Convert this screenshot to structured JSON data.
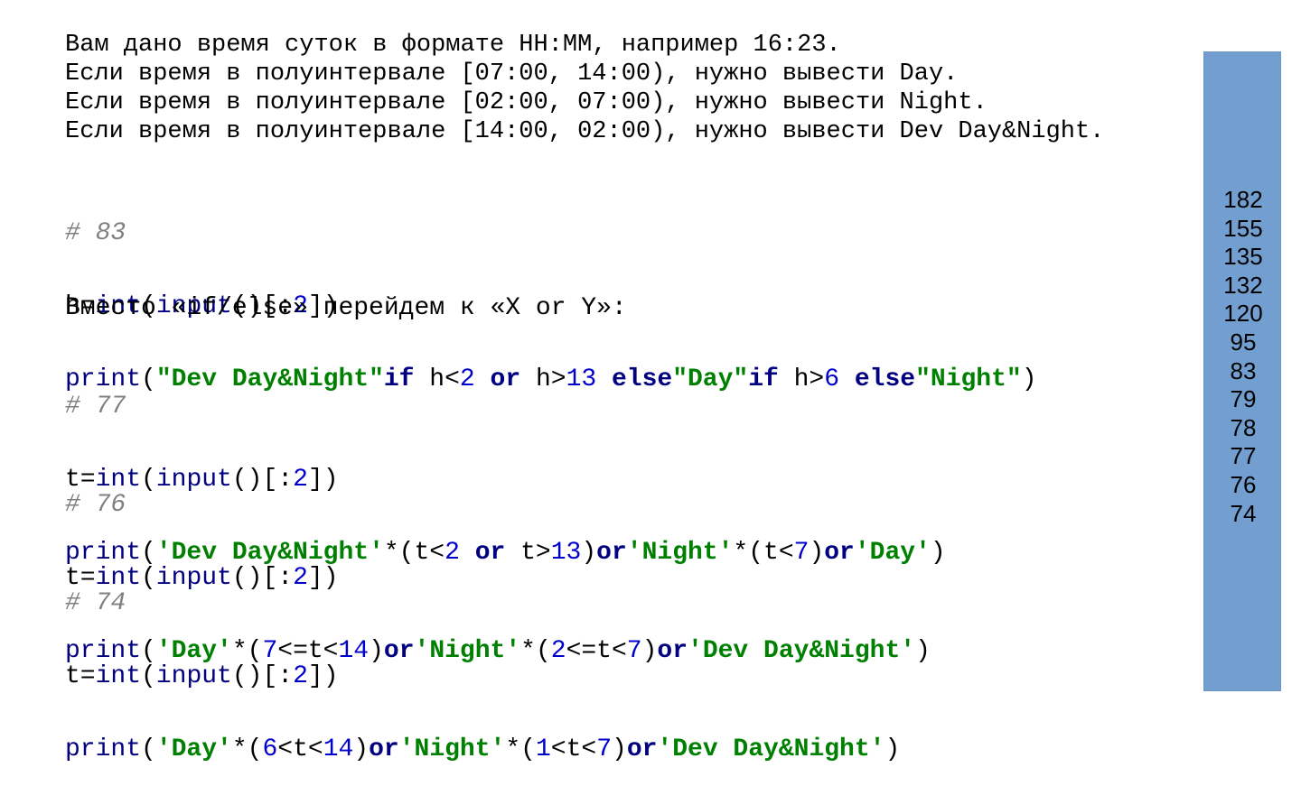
{
  "task_lines": [
    "Вам дано время суток в формате HH:MM, например 16:23.",
    "Если время в полуинтервале [07:00, 14:00), нужно вывести Day.",
    "Если время в полуинтервале [02:00, 07:00), нужно вывести Night.",
    "Если время в полуинтервале [14:00, 02:00), нужно вывести Dev Day&Night."
  ],
  "block1": {
    "comment": "# 83",
    "line1": [
      "h=",
      "int",
      "(",
      "input",
      "()[:",
      "2",
      "])"
    ],
    "line2": [
      "print",
      "(",
      "\"Dev Day&Night\"",
      "if",
      " h<",
      "2",
      " ",
      "or",
      " h>",
      "13",
      " ",
      "else",
      "\"Day\"",
      "if",
      " h>",
      "6",
      " ",
      "else",
      "\"Night\"",
      ")"
    ]
  },
  "paragraph": "Вместо «if/else» перейдем к «X or Y»:",
  "block2": {
    "comment": "# 77",
    "line1": [
      "t=",
      "int",
      "(",
      "input",
      "()[:",
      "2",
      "])"
    ],
    "line2": [
      "print",
      "(",
      "'Dev Day&Night'",
      "*(t<",
      "2",
      " ",
      "or",
      " t>",
      "13",
      ")",
      "or",
      "'Night'",
      "*(t<",
      "7",
      ")",
      "or",
      "'Day'",
      ")"
    ]
  },
  "block3": {
    "comment": "# 76",
    "line1": [
      "t=",
      "int",
      "(",
      "input",
      "()[:",
      "2",
      "])"
    ],
    "line2": [
      "print",
      "(",
      "'Day'",
      "*(",
      "7",
      "<=t<",
      "14",
      ")",
      "or",
      "'Night'",
      "*(",
      "2",
      "<=t<",
      "7",
      ")",
      "or",
      "'Dev Day&Night'",
      ")"
    ]
  },
  "block4": {
    "comment": "# 74",
    "line1": [
      "t=",
      "int",
      "(",
      "input",
      "()[:",
      "2",
      "])"
    ],
    "line2": [
      "print",
      "(",
      "'Day'",
      "*(",
      "6",
      "<t<",
      "14",
      ")",
      "or",
      "'Night'",
      "*(",
      "1",
      "<t<",
      "7",
      ")",
      "or",
      "'Dev Day&Night'",
      ")"
    ]
  },
  "sidebar": {
    "scores": [
      "182",
      "155",
      "135",
      "132",
      "120",
      "95",
      "83",
      "79",
      "78",
      "77",
      "76",
      "74"
    ]
  },
  "colors": {
    "sidebar_bg": "#729fcf",
    "keyword": "#000080",
    "number": "#0000cc",
    "string": "#008000",
    "comment": "#808080"
  }
}
